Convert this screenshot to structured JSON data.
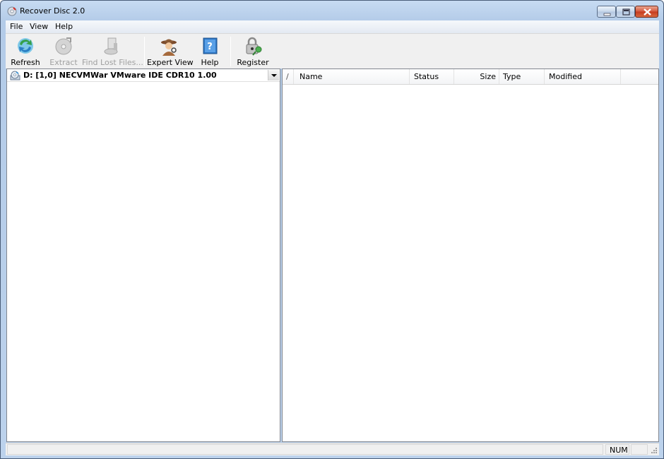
{
  "window": {
    "title": "Recover Disc 2.0",
    "app_icon": "cd-icon"
  },
  "menu": {
    "items": [
      "File",
      "View",
      "Help"
    ]
  },
  "toolbar": {
    "buttons": [
      {
        "label": "Refresh",
        "icon": "refresh-icon",
        "enabled": true
      },
      {
        "label": "Extract",
        "icon": "extract-disc-icon",
        "enabled": false
      },
      {
        "label": "Find Lost Files...",
        "icon": "find-files-icon",
        "enabled": false
      },
      {
        "label": "Expert View",
        "icon": "detective-icon",
        "enabled": true
      },
      {
        "label": "Help",
        "icon": "help-book-icon",
        "enabled": true
      },
      {
        "label": "Register",
        "icon": "padlock-key-icon",
        "enabled": true
      }
    ]
  },
  "drive_select": {
    "value": "D: [1,0] NECVMWar VMware IDE CDR10 1.00",
    "icon": "cd-drive-icon"
  },
  "file_list": {
    "sort_indicator": "/",
    "columns": [
      "Name",
      "Status",
      "Size",
      "Type",
      "Modified"
    ]
  },
  "statusbar": {
    "main_text": "",
    "num_indicator": "NUM"
  },
  "colors": {
    "title_gradient_top": "#c7dbf2",
    "close_button": "#c53a1f",
    "pane_border": "#828790"
  }
}
